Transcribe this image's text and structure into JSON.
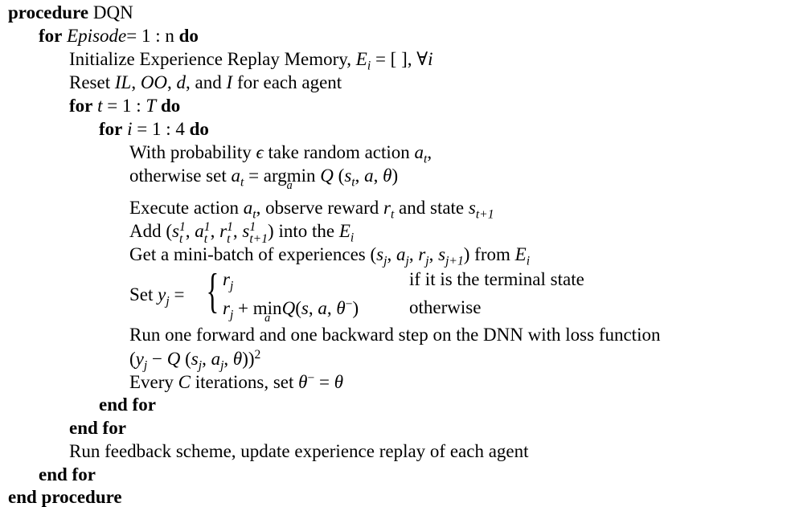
{
  "algorithm": {
    "procedure_keyword": "procedure",
    "procedure_name": "DQN",
    "end_procedure": "end procedure",
    "for_kw": "for",
    "do_kw": "do",
    "end_for": "end for",
    "outer_loop_var": "Episode",
    "outer_loop_range": "= 1 : n",
    "init_text": "Initialize Experience Replay Memory, ",
    "init_math": "E",
    "init_sub": "i",
    "init_rest": " = [ ],  ∀",
    "init_forall_var": "i",
    "reset_prefix": "Reset ",
    "reset_vars": [
      "IL",
      "OO",
      "d",
      "I"
    ],
    "reset_suffix": " for each agent",
    "t_loop_var": "t",
    "t_loop_range": "= 1 : ",
    "t_loop_end": "T",
    "i_loop_var": "i",
    "i_loop_range": "= 1 : 4",
    "line_epsilon": "With probability ",
    "epsilon": "ϵ",
    "line_epsilon_rest": " take random action ",
    "otherwise_set": "otherwise set ",
    "argmin": "argmin",
    "argmin_sub": "a",
    "q_expr": "Q (s",
    "q_expr_rest": ", a, θ)",
    "execute_text": "Execute action ",
    "observe_text": ", observe reward ",
    "and_state_text": " and state ",
    "add_text": "Add (",
    "into_text": ") into the ",
    "minibatch_text": "Get a mini-batch of experiences (",
    "from_text": ") from ",
    "set_text": "Set ",
    "case1_cond": "if it is the terminal state",
    "case2_min": "min",
    "case2_cond": "otherwise",
    "run_text": "Run one forward and one backward step on the DNN with loss function",
    "every_text": "Every ",
    "every_var": "C",
    "iterations_text": " iterations, set ",
    "feedback_text": "Run feedback scheme, update experience replay of each agent"
  }
}
